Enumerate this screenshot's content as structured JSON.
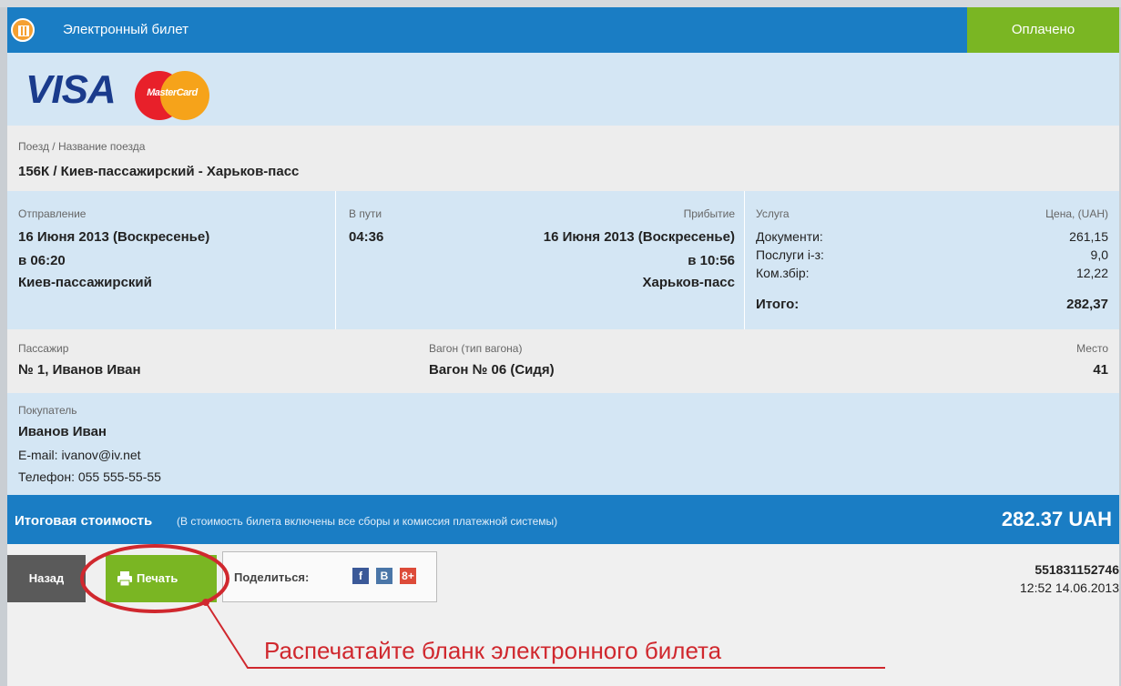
{
  "header": {
    "title": "Электронный билет",
    "status": "Оплачено"
  },
  "logos": {
    "visa": "VISA",
    "mastercard": "MasterCard"
  },
  "train": {
    "label": "Поезд / Название поезда",
    "value": "156К / Киев-пассажирский - Харьков-пасс"
  },
  "journey": {
    "departure_label": "Отправление",
    "departure_date": "16 Июня 2013 (Воскресенье)",
    "departure_time": "в 06:20",
    "departure_station": "Киев-пассажирский",
    "duration_label": "В пути",
    "duration": "04:36",
    "arrival_label": "Прибытие",
    "arrival_date": "16 Июня 2013 (Воскресенье)",
    "arrival_time": "в 10:56",
    "arrival_station": "Харьков-пасс"
  },
  "pricing": {
    "service_label": "Услуга",
    "price_label": "Цена, (UAH)",
    "items": [
      {
        "name": "Документи:",
        "price": "261,15"
      },
      {
        "name": "Послуги і-з:",
        "price": "9,0"
      },
      {
        "name": "Ком.збір:",
        "price": "12,22"
      }
    ],
    "total_label": "Итого:",
    "total": "282,37"
  },
  "passenger": {
    "label": "Пассажир",
    "value": "№ 1, Иванов Иван",
    "car_label": "Вагон (тип вагона)",
    "car_value": "Вагон № 06 (Сидя)",
    "seat_label": "Место",
    "seat_value": "41"
  },
  "buyer": {
    "label": "Покупатель",
    "name": "Иванов Иван",
    "email": "E-mail: ivanov@iv.net",
    "phone": "Телефон: 055 555-55-55"
  },
  "total_bar": {
    "label": "Итоговая стоимость",
    "note": "(В стоимость билета включены все сборы и комиссия платежной системы)",
    "sum": "282.37 UAH"
  },
  "actions": {
    "back": "Назад",
    "print": "Печать",
    "share_label": "Поделиться:",
    "share_fb": "f",
    "share_vk": "B",
    "share_gp": "8+"
  },
  "order": {
    "number": "551831152746",
    "datetime": "12:52 14.06.2013"
  },
  "callout": "Распечатайте бланк электронного билета",
  "colors": {
    "header_blue": "#1a7dc4",
    "paid_green": "#7ab623",
    "callout_red": "#d0282e"
  }
}
